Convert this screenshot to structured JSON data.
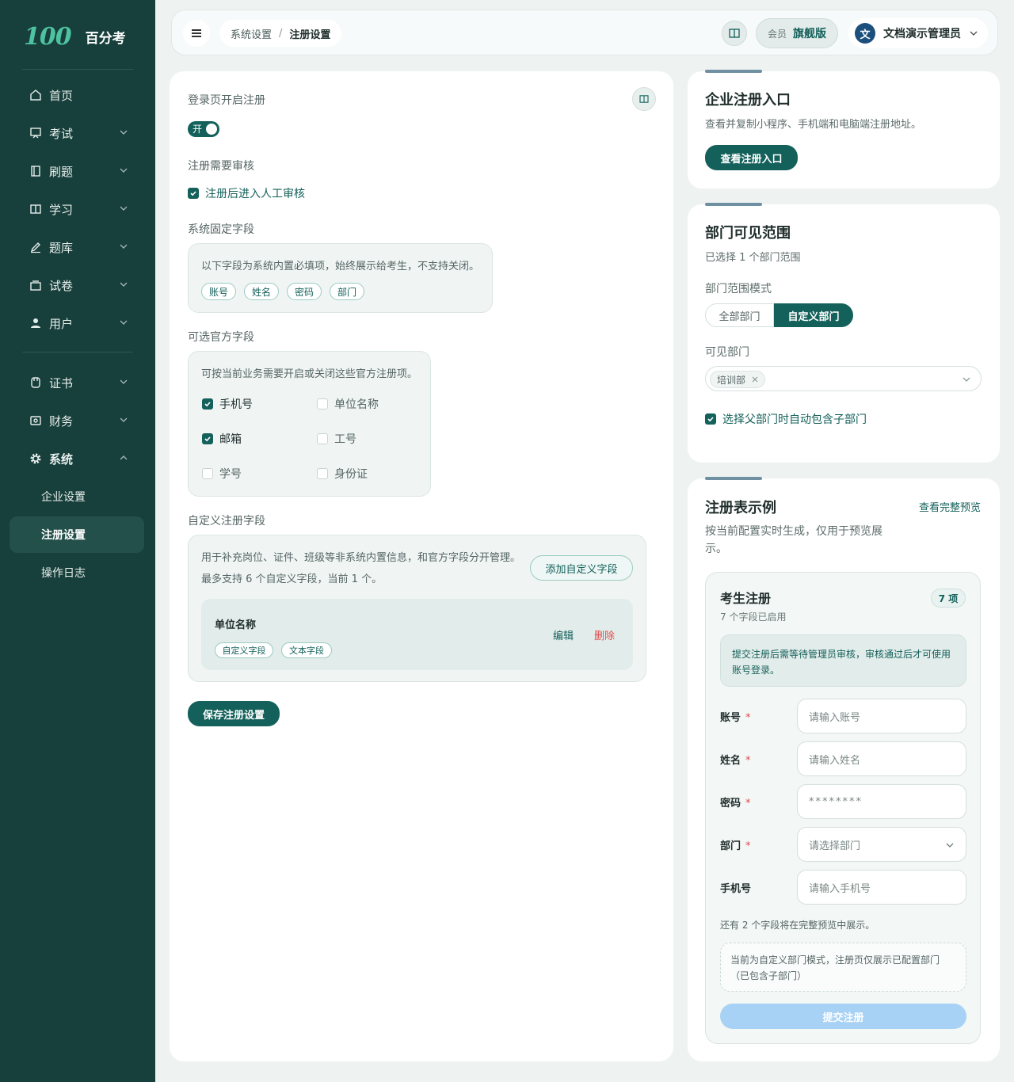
{
  "brand": {
    "logo": "100",
    "name": "百分考"
  },
  "sidebar": {
    "items": [
      {
        "label": "首页",
        "icon": "home-icon"
      },
      {
        "label": "考试",
        "icon": "exam-icon"
      },
      {
        "label": "刷题",
        "icon": "practice-icon"
      },
      {
        "label": "学习",
        "icon": "book-icon"
      },
      {
        "label": "题库",
        "icon": "pen-icon"
      },
      {
        "label": "试卷",
        "icon": "paper-icon"
      },
      {
        "label": "用户",
        "icon": "user-icon"
      },
      {
        "label": "证书",
        "icon": "certificate-icon"
      },
      {
        "label": "财务",
        "icon": "finance-icon"
      },
      {
        "label": "系统",
        "icon": "gear-icon"
      }
    ],
    "sub_items": [
      {
        "label": "企业设置"
      },
      {
        "label": "注册设置"
      },
      {
        "label": "操作日志"
      }
    ]
  },
  "topbar": {
    "breadcrumb": [
      "系统设置",
      "注册设置"
    ],
    "breadcrumb_sep": "/",
    "member_label": "会员",
    "member_tier": "旗舰版",
    "avatar_char": "文",
    "user_name": "文档演示管理员"
  },
  "main": {
    "open_register_label": "登录页开启注册",
    "toggle_text": "开",
    "review_label": "注册需要审核",
    "review_option": "注册后进入人工审核",
    "fixed_label": "系统固定字段",
    "fixed_desc": "以下字段为系统内置必填项，始终展示给考生，不支持关闭。",
    "fixed_tags": [
      "账号",
      "姓名",
      "密码",
      "部门"
    ],
    "optional_label": "可选官方字段",
    "optional_desc": "可按当前业务需要开启或关闭这些官方注册项。",
    "optional_fields": [
      {
        "label": "手机号",
        "checked": true
      },
      {
        "label": "单位名称",
        "checked": false
      },
      {
        "label": "邮箱",
        "checked": true
      },
      {
        "label": "工号",
        "checked": false
      },
      {
        "label": "学号",
        "checked": false
      },
      {
        "label": "身份证",
        "checked": false
      }
    ],
    "custom_label": "自定义注册字段",
    "custom_desc1": "用于补充岗位、证件、班级等非系统内置信息，和官方字段分开管理。",
    "custom_desc2": "最多支持 6 个自定义字段，当前 1 个。",
    "add_custom_button": "添加自定义字段",
    "custom_field": {
      "name": "单位名称",
      "tags": [
        "自定义字段",
        "文本字段"
      ],
      "edit": "编辑",
      "delete": "删除"
    },
    "save_button": "保存注册设置"
  },
  "entry_card": {
    "title": "企业注册入口",
    "desc": "查看并复制小程序、手机端和电脑端注册地址。",
    "button": "查看注册入口"
  },
  "dept_card": {
    "title": "部门可见范围",
    "selected_summary": "已选择 1 个部门范围",
    "mode_label": "部门范围模式",
    "modes": [
      "全部部门",
      "自定义部门"
    ],
    "active_mode": "自定义部门",
    "visible_label": "可见部门",
    "selected_dept": "培训部",
    "include_children": "选择父部门时自动包含子部门"
  },
  "example_card": {
    "title": "注册表示例",
    "full_preview_link": "查看完整预览",
    "desc_line1": "按当前配置实时生成，仅用于预览展",
    "desc_line2": "示。",
    "preview": {
      "title": "考生注册",
      "count_badge": "7 项",
      "enabled_summary": "7 个字段已启用",
      "notice_line1": "提交注册后需等待管理员审核，审核通过后才可使用",
      "notice_line2": "账号登录。",
      "fields": [
        {
          "label": "账号",
          "required": "*",
          "placeholder": "请输入账号"
        },
        {
          "label": "姓名",
          "required": "*",
          "placeholder": "请输入姓名"
        },
        {
          "label": "密码",
          "required": "*",
          "placeholder": "********"
        },
        {
          "label": "部门",
          "required": "*",
          "placeholder": "请选择部门"
        },
        {
          "label": "手机号",
          "required": "",
          "placeholder": "请输入手机号"
        }
      ],
      "more_fields_note": "还有 2 个字段将在完整预览中展示。",
      "dept_note_line1": "当前为自定义部门模式，注册页仅展示已配置部门",
      "dept_note_line2": "（已包含子部门）",
      "submit_button": "提交注册"
    }
  },
  "colors": {
    "sidebar_bg": "#173f3b",
    "primary": "#14605a",
    "danger": "#e04b4b",
    "submit_disabled": "#a8d2f5"
  }
}
